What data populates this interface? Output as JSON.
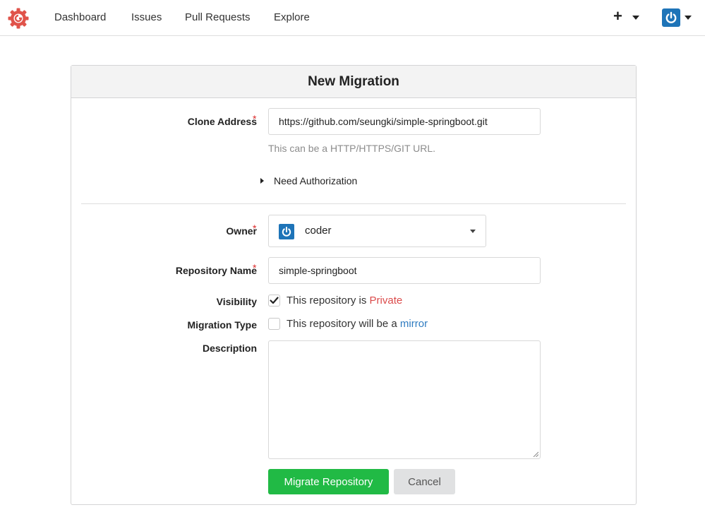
{
  "nav": {
    "items": [
      {
        "label": "Dashboard"
      },
      {
        "label": "Issues"
      },
      {
        "label": "Pull Requests"
      },
      {
        "label": "Explore"
      }
    ],
    "plus_icon": "plus-icon",
    "avatar_icon": "power-icon"
  },
  "card": {
    "title": "New Migration"
  },
  "form": {
    "clone_address": {
      "label": "Clone Address",
      "required_mark": "*",
      "value": "https://github.com/seungki/simple-springboot.git",
      "hint": "This can be a HTTP/HTTPS/GIT URL."
    },
    "auth_toggle": {
      "label": "Need Authorization",
      "expanded": false
    },
    "owner": {
      "label": "Owner",
      "required_mark": "*",
      "selected": "coder"
    },
    "repo_name": {
      "label": "Repository Name",
      "required_mark": "*",
      "value": "simple-springboot"
    },
    "visibility": {
      "label": "Visibility",
      "checked": true,
      "text": "This repository is ",
      "keyword": "Private"
    },
    "migration_type": {
      "label": "Migration Type",
      "checked": false,
      "text": "This repository will be a ",
      "keyword": "mirror"
    },
    "description": {
      "label": "Description",
      "value": ""
    },
    "submit_label": "Migrate Repository",
    "cancel_label": "Cancel"
  },
  "colors": {
    "primary": "#21ba45",
    "avatar": "#1e74b8",
    "logo": "#e0534a",
    "required": "#db2828",
    "private": "#db4b4b",
    "mirror": "#2f7cc1"
  }
}
